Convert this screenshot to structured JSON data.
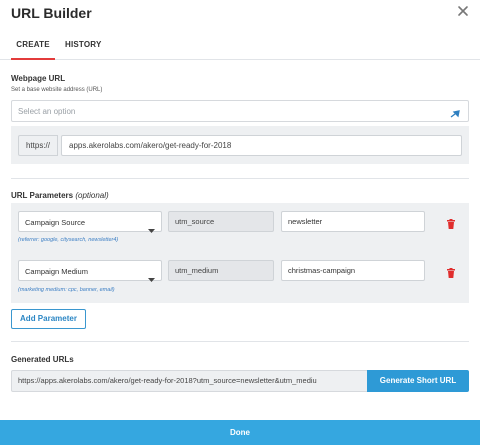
{
  "dialog": {
    "title": "URL Builder"
  },
  "tabs": [
    {
      "label": "CREATE",
      "active": true
    },
    {
      "label": "HISTORY",
      "active": false
    }
  ],
  "webpage": {
    "label": "Webpage URL",
    "hint": "Set a base website address (URL)",
    "select_placeholder": "Select an option",
    "protocol": "https://",
    "url_value": "apps.akerolabs.com/akero/get-ready-for-2018"
  },
  "params": {
    "label": "URL Parameters",
    "optional": "(optional)",
    "rows": [
      {
        "dropdown": "Campaign Source",
        "key": "utm_source",
        "value": "newsletter",
        "hint": "(referrer: google, citysearch, newsletter4)"
      },
      {
        "dropdown": "Campaign Medium",
        "key": "utm_medium",
        "value": "christmas-campaign",
        "hint": "(marketing medium: cpc, banner, email)"
      }
    ],
    "add_button": "Add Parameter"
  },
  "generated": {
    "label": "Generated URLs",
    "url": "https://apps.akerolabs.com/akero/get-ready-for-2018?utm_source=newsletter&utm_mediu",
    "button": "Generate Short URL"
  },
  "footer": {
    "done": "Done"
  },
  "colors": {
    "accent_red": "#e33b3b",
    "primary_blue": "#2e9ad6",
    "done_blue": "#35a7e0",
    "trash_red": "#e02d2d"
  }
}
